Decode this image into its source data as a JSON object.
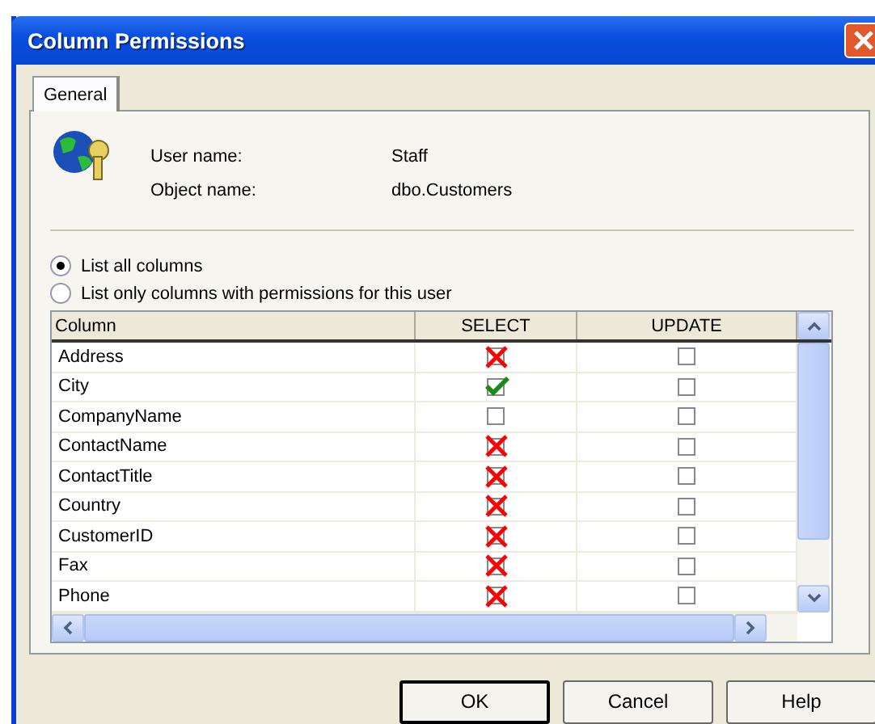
{
  "window": {
    "title": "Column Permissions"
  },
  "tabs": [
    {
      "label": "General",
      "selected": true
    }
  ],
  "info": [
    {
      "label": "User name:",
      "value": "Staff"
    },
    {
      "label": "Object name:",
      "value": "dbo.Customers"
    }
  ],
  "list_options": [
    {
      "label": "List all columns",
      "selected": true
    },
    {
      "label": "List only columns with permissions for this user",
      "selected": false
    }
  ],
  "table": {
    "columns": [
      "Column",
      "SELECT",
      "UPDATE"
    ],
    "rows": [
      {
        "column": "Address",
        "select": {
          "granted": false,
          "denied": true
        },
        "update": {
          "granted": false,
          "denied": false
        }
      },
      {
        "column": "City",
        "select": {
          "granted": true,
          "denied": false
        },
        "update": {
          "granted": false,
          "denied": false
        }
      },
      {
        "column": "CompanyName",
        "select": {
          "granted": false,
          "denied": false
        },
        "update": {
          "granted": false,
          "denied": false
        }
      },
      {
        "column": "ContactName",
        "select": {
          "granted": false,
          "denied": true
        },
        "update": {
          "granted": false,
          "denied": false
        }
      },
      {
        "column": "ContactTitle",
        "select": {
          "granted": false,
          "denied": true
        },
        "update": {
          "granted": false,
          "denied": false
        }
      },
      {
        "column": "Country",
        "select": {
          "granted": false,
          "denied": true
        },
        "update": {
          "granted": false,
          "denied": false
        }
      },
      {
        "column": "CustomerID",
        "select": {
          "granted": false,
          "denied": true
        },
        "update": {
          "granted": false,
          "denied": false
        }
      },
      {
        "column": "Fax",
        "select": {
          "granted": false,
          "denied": true
        },
        "update": {
          "granted": false,
          "denied": false
        }
      },
      {
        "column": "Phone",
        "select": {
          "granted": false,
          "denied": true
        },
        "update": {
          "granted": false,
          "denied": false
        }
      }
    ]
  },
  "buttons": [
    {
      "label": "OK",
      "default": true
    },
    {
      "label": "Cancel",
      "default": false
    },
    {
      "label": "Help",
      "default": false
    }
  ]
}
